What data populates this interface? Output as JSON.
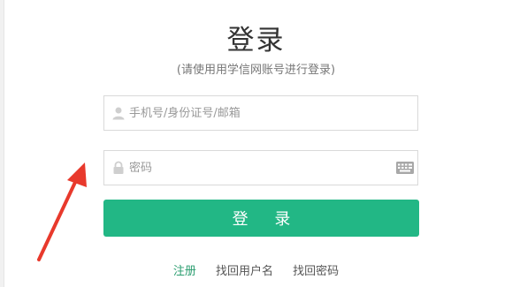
{
  "page": {
    "title": "登录",
    "subtitle": "(请使用用学信网账号进行登录)"
  },
  "form": {
    "phone": {
      "placeholder": "手机号/身份证号/邮箱",
      "icon": "user-icon"
    },
    "password": {
      "placeholder": "密码",
      "icon": "lock-icon",
      "extra_icon": "keyboard-icon"
    },
    "submit_label": "登 录"
  },
  "links": {
    "register": "注册",
    "recover_username": "找回用户名",
    "recover_password": "找回密码"
  },
  "colors": {
    "accent": "#22b785",
    "register_link": "#2a9d6f",
    "annotation_arrow": "#e8392c"
  }
}
